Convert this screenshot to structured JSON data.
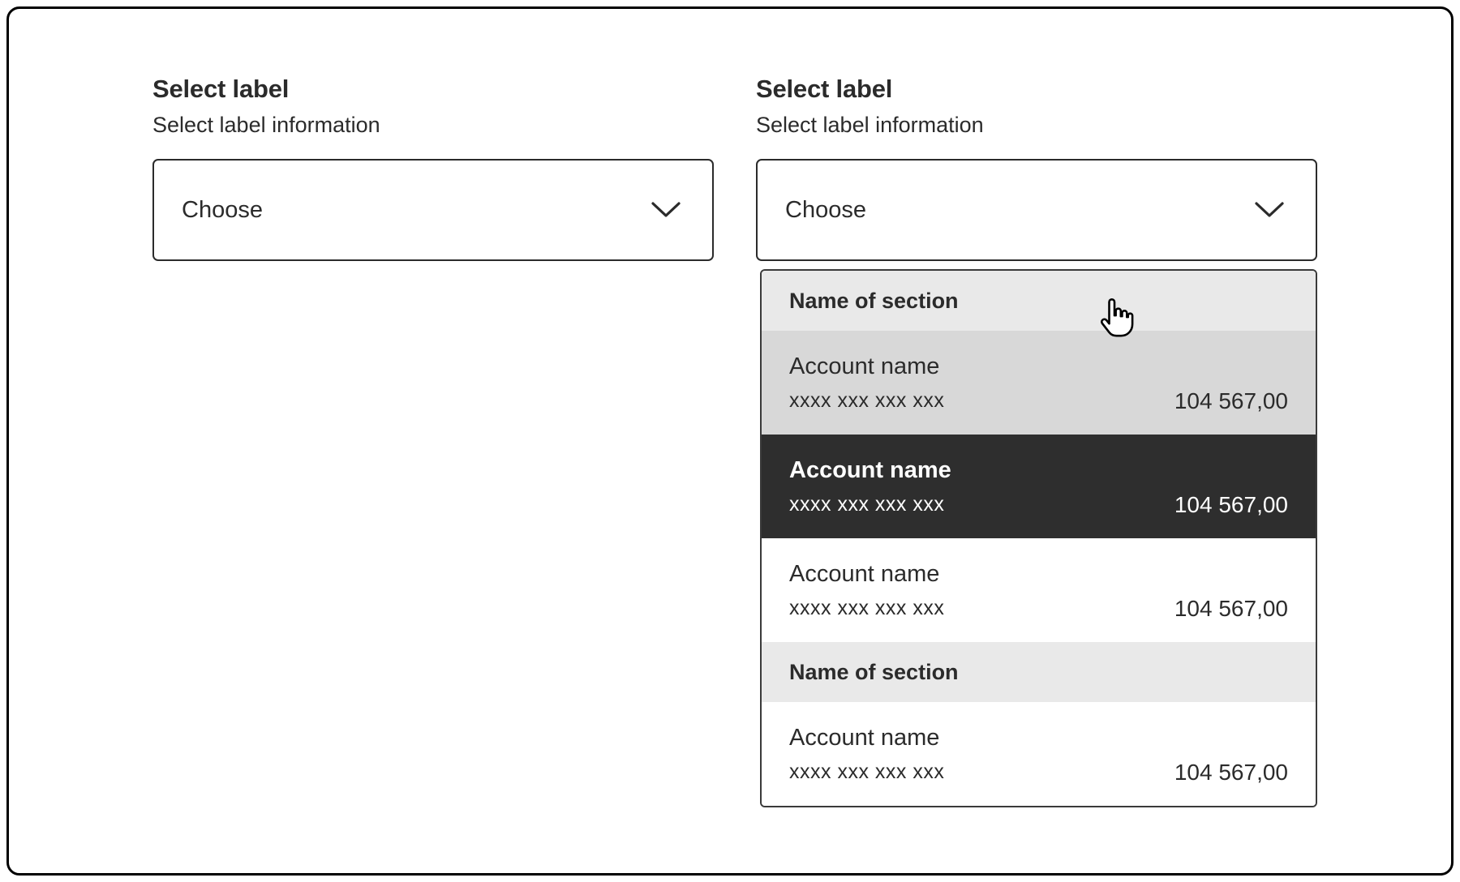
{
  "frame": {
    "background": "#ffffff",
    "border_color": "#000000"
  },
  "colors": {
    "text": "#2b2b2b",
    "frame_border": "#000000",
    "section_bg": "#e9e9e9",
    "hover_bg": "#d8d8d8",
    "selected_bg": "#2e2e2e",
    "selected_text": "#ffffff"
  },
  "selects": {
    "left": {
      "label": "Select label",
      "info": "Select label information",
      "value": "Choose",
      "open": false
    },
    "right": {
      "label": "Select label",
      "info": "Select label information",
      "value": "Choose",
      "open": true
    }
  },
  "dropdown": {
    "groups": [
      {
        "section": "Name of section",
        "items": [
          {
            "title": "Account name",
            "number": "xxxx xxx xxx xxx",
            "amount": "104 567,00",
            "state": "hover"
          },
          {
            "title": "Account name",
            "number": "xxxx xxx xxx xxx",
            "amount": "104 567,00",
            "state": "selected"
          },
          {
            "title": "Account name",
            "number": "xxxx xxx xxx xxx",
            "amount": "104 567,00",
            "state": "default"
          }
        ]
      },
      {
        "section": "Name of section",
        "items": [
          {
            "title": "Account name",
            "number": "xxxx xxx xxx xxx",
            "amount": "104 567,00",
            "state": "default"
          }
        ]
      }
    ]
  },
  "icons": {
    "chevron_down": "chevron-down",
    "cursor": "hand-pointer"
  }
}
